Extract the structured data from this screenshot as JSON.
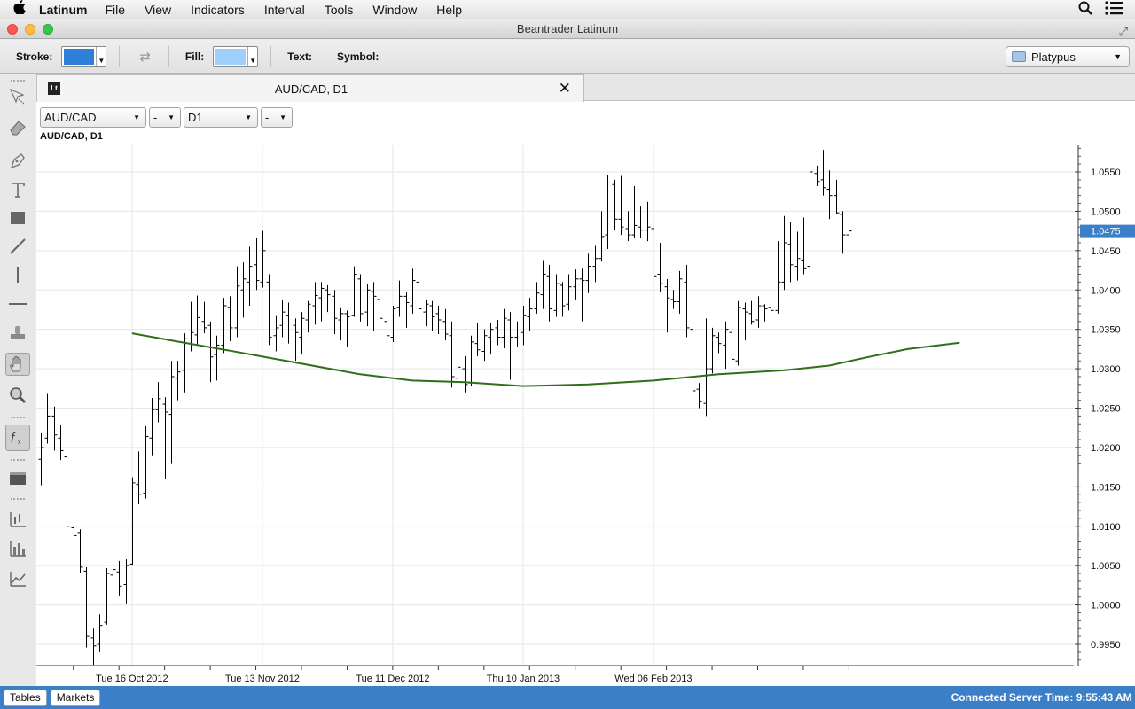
{
  "menubar": {
    "apple": "",
    "app_name": "Latinum",
    "items": [
      "File",
      "View",
      "Indicators",
      "Interval",
      "Tools",
      "Window",
      "Help"
    ],
    "icons": [
      "search-icon",
      "list-icon"
    ]
  },
  "window": {
    "title": "Beantrader Latinum"
  },
  "toolbar": {
    "stroke_label": "Stroke:",
    "stroke_color": "#2f7fd6",
    "fill_label": "Fill:",
    "fill_color": "#9fd0fb",
    "text_label": "Text:",
    "symbol_label": "Symbol:",
    "workspace": "Platypus"
  },
  "tab": {
    "logo": "Lt",
    "title": "AUD/CAD, D1"
  },
  "selectors": {
    "pair": "AUD/CAD",
    "pair_option": "-",
    "timeframe": "D1",
    "timeframe_option": "-"
  },
  "chart_label": "AUD/CAD, D1",
  "statusbar": {
    "tables_label": "Tables",
    "markets_label": "Markets",
    "status": "Connected  Server Time: 9:55:43 AM t"
  },
  "chart_data": {
    "type": "ohlc",
    "symbol": "AUD/CAD",
    "timeframe": "D1",
    "ylim": [
      0.9925,
      1.058
    ],
    "y_ticks": [
      "1.0550",
      "1.0500",
      "1.0450",
      "1.0400",
      "1.0350",
      "1.0300",
      "1.0250",
      "1.0200",
      "1.0150",
      "1.0100",
      "1.0050",
      "1.0000",
      "0.9950"
    ],
    "x_labels": [
      "Tue 16 Oct 2012",
      "Tue 13 Nov 2012",
      "Tue 11 Dec 2012",
      "Thu 10 Jan 2013",
      "Wed 06 Feb 2013"
    ],
    "x_label_bar_index": [
      14,
      34,
      54,
      74,
      94
    ],
    "current_price": "1.0475",
    "colors": {
      "bars": "#000000",
      "moving_average": "#2f6e1a",
      "price_marker": "#3a7fc8",
      "grid": "#e6e6e6"
    },
    "bars": [
      {
        "o": 1.0185,
        "h": 1.0218,
        "l": 1.0152,
        "c": 1.02
      },
      {
        "o": 1.0212,
        "h": 1.0268,
        "l": 1.0205,
        "c": 1.024
      },
      {
        "o": 1.024,
        "h": 1.0252,
        "l": 1.0196,
        "c": 1.0216
      },
      {
        "o": 1.0212,
        "h": 1.0228,
        "l": 1.0184,
        "c": 1.0196
      },
      {
        "o": 1.0188,
        "h": 1.0196,
        "l": 1.0092,
        "c": 1.01
      },
      {
        "o": 1.0098,
        "h": 1.0108,
        "l": 1.0052,
        "c": 1.0088
      },
      {
        "o": 1.0092,
        "h": 1.0096,
        "l": 1.004,
        "c": 1.0048
      },
      {
        "o": 1.0043,
        "h": 1.0048,
        "l": 0.9946,
        "c": 0.996
      },
      {
        "o": 0.9958,
        "h": 0.997,
        "l": 0.9924,
        "c": 0.9948
      },
      {
        "o": 0.995,
        "h": 0.9988,
        "l": 0.994,
        "c": 0.9974
      },
      {
        "o": 0.9978,
        "h": 1.0047,
        "l": 0.9975,
        "c": 1.004
      },
      {
        "o": 1.0038,
        "h": 1.009,
        "l": 1.0022,
        "c": 1.0045
      },
      {
        "o": 1.0042,
        "h": 1.0056,
        "l": 1.0012,
        "c": 1.0024
      },
      {
        "o": 1.0026,
        "h": 1.0058,
        "l": 1.0002,
        "c": 1.005
      },
      {
        "o": 1.0052,
        "h": 1.0162,
        "l": 1.005,
        "c": 1.0155
      },
      {
        "o": 1.0153,
        "h": 1.0195,
        "l": 1.0128,
        "c": 1.014
      },
      {
        "o": 1.0142,
        "h": 1.0227,
        "l": 1.0135,
        "c": 1.0214
      },
      {
        "o": 1.0212,
        "h": 1.0263,
        "l": 1.019,
        "c": 1.0248
      },
      {
        "o": 1.0248,
        "h": 1.0283,
        "l": 1.0232,
        "c": 1.0262
      },
      {
        "o": 1.0255,
        "h": 1.0264,
        "l": 1.016,
        "c": 1.0245
      },
      {
        "o": 1.0242,
        "h": 1.031,
        "l": 1.018,
        "c": 1.029
      },
      {
        "o": 1.0288,
        "h": 1.031,
        "l": 1.026,
        "c": 1.0296
      },
      {
        "o": 1.0298,
        "h": 1.0345,
        "l": 1.027,
        "c": 1.0338
      },
      {
        "o": 1.0332,
        "h": 1.0385,
        "l": 1.0322,
        "c": 1.0346
      },
      {
        "o": 1.0343,
        "h": 1.0393,
        "l": 1.033,
        "c": 1.0365
      },
      {
        "o": 1.036,
        "h": 1.0385,
        "l": 1.0345,
        "c": 1.0352
      },
      {
        "o": 1.0355,
        "h": 1.036,
        "l": 1.0283,
        "c": 1.0315
      },
      {
        "o": 1.0318,
        "h": 1.0342,
        "l": 1.0285,
        "c": 1.033
      },
      {
        "o": 1.033,
        "h": 1.039,
        "l": 1.032,
        "c": 1.038
      },
      {
        "o": 1.0378,
        "h": 1.0392,
        "l": 1.0335,
        "c": 1.0352
      },
      {
        "o": 1.0352,
        "h": 1.043,
        "l": 1.034,
        "c": 1.0405
      },
      {
        "o": 1.04,
        "h": 1.0435,
        "l": 1.0365,
        "c": 1.0414
      },
      {
        "o": 1.041,
        "h": 1.0455,
        "l": 1.038,
        "c": 1.043
      },
      {
        "o": 1.0432,
        "h": 1.0466,
        "l": 1.04,
        "c": 1.0412
      },
      {
        "o": 1.041,
        "h": 1.0475,
        "l": 1.0403,
        "c": 1.045
      },
      {
        "o": 1.041,
        "h": 1.042,
        "l": 1.033,
        "c": 1.034
      },
      {
        "o": 1.0342,
        "h": 1.0368,
        "l": 1.0322,
        "c": 1.0352
      },
      {
        "o": 1.0355,
        "h": 1.0388,
        "l": 1.034,
        "c": 1.0372
      },
      {
        "o": 1.0368,
        "h": 1.0384,
        "l": 1.0332,
        "c": 1.0358
      },
      {
        "o": 1.0355,
        "h": 1.0364,
        "l": 1.031,
        "c": 1.0346
      },
      {
        "o": 1.034,
        "h": 1.0372,
        "l": 1.0318,
        "c": 1.0364
      },
      {
        "o": 1.0362,
        "h": 1.0386,
        "l": 1.0346,
        "c": 1.0382
      },
      {
        "o": 1.038,
        "h": 1.041,
        "l": 1.0356,
        "c": 1.0393
      },
      {
        "o": 1.039,
        "h": 1.041,
        "l": 1.036,
        "c": 1.0402
      },
      {
        "o": 1.04,
        "h": 1.0406,
        "l": 1.0372,
        "c": 1.0394
      },
      {
        "o": 1.0392,
        "h": 1.04,
        "l": 1.0344,
        "c": 1.0364
      },
      {
        "o": 1.0362,
        "h": 1.0378,
        "l": 1.0336,
        "c": 1.037
      },
      {
        "o": 1.037,
        "h": 1.0374,
        "l": 1.0328,
        "c": 1.0366
      },
      {
        "o": 1.0368,
        "h": 1.043,
        "l": 1.0366,
        "c": 1.042
      },
      {
        "o": 1.0414,
        "h": 1.042,
        "l": 1.036,
        "c": 1.037
      },
      {
        "o": 1.0372,
        "h": 1.0408,
        "l": 1.0354,
        "c": 1.04
      },
      {
        "o": 1.0398,
        "h": 1.041,
        "l": 1.0348,
        "c": 1.0392
      },
      {
        "o": 1.0388,
        "h": 1.0398,
        "l": 1.0336,
        "c": 1.0364
      },
      {
        "o": 1.036,
        "h": 1.0366,
        "l": 1.0318,
        "c": 1.0342
      },
      {
        "o": 1.034,
        "h": 1.038,
        "l": 1.0334,
        "c": 1.0376
      },
      {
        "o": 1.0378,
        "h": 1.0412,
        "l": 1.0366,
        "c": 1.0392
      },
      {
        "o": 1.0392,
        "h": 1.0398,
        "l": 1.0352,
        "c": 1.0384
      },
      {
        "o": 1.038,
        "h": 1.0428,
        "l": 1.037,
        "c": 1.0412
      },
      {
        "o": 1.041,
        "h": 1.0418,
        "l": 1.0362,
        "c": 1.0376
      },
      {
        "o": 1.0372,
        "h": 1.0388,
        "l": 1.0354,
        "c": 1.0382
      },
      {
        "o": 1.038,
        "h": 1.0386,
        "l": 1.0348,
        "c": 1.0366
      },
      {
        "o": 1.037,
        "h": 1.038,
        "l": 1.0344,
        "c": 1.0362
      },
      {
        "o": 1.036,
        "h": 1.0376,
        "l": 1.0336,
        "c": 1.0344
      },
      {
        "o": 1.0342,
        "h": 1.036,
        "l": 1.0276,
        "c": 1.029
      },
      {
        "o": 1.0288,
        "h": 1.0312,
        "l": 1.0276,
        "c": 1.0302
      },
      {
        "o": 1.03,
        "h": 1.0316,
        "l": 1.027,
        "c": 1.028
      },
      {
        "o": 1.0282,
        "h": 1.0342,
        "l": 1.0278,
        "c": 1.0334
      },
      {
        "o": 1.0332,
        "h": 1.0358,
        "l": 1.0316,
        "c": 1.0324
      },
      {
        "o": 1.0322,
        "h": 1.035,
        "l": 1.031,
        "c": 1.0342
      },
      {
        "o": 1.034,
        "h": 1.0358,
        "l": 1.0318,
        "c": 1.035
      },
      {
        "o": 1.0352,
        "h": 1.0362,
        "l": 1.033,
        "c": 1.034
      },
      {
        "o": 1.034,
        "h": 1.0376,
        "l": 1.0326,
        "c": 1.0364
      },
      {
        "o": 1.0362,
        "h": 1.0372,
        "l": 1.0286,
        "c": 1.034
      },
      {
        "o": 1.034,
        "h": 1.036,
        "l": 1.0328,
        "c": 1.0348
      },
      {
        "o": 1.0346,
        "h": 1.038,
        "l": 1.033,
        "c": 1.0368
      },
      {
        "o": 1.0366,
        "h": 1.039,
        "l": 1.0348,
        "c": 1.0376
      },
      {
        "o": 1.0376,
        "h": 1.041,
        "l": 1.037,
        "c": 1.0396
      },
      {
        "o": 1.0394,
        "h": 1.0438,
        "l": 1.0376,
        "c": 1.042
      },
      {
        "o": 1.0418,
        "h": 1.0432,
        "l": 1.036,
        "c": 1.0376
      },
      {
        "o": 1.0374,
        "h": 1.042,
        "l": 1.0366,
        "c": 1.0408
      },
      {
        "o": 1.0406,
        "h": 1.041,
        "l": 1.0366,
        "c": 1.038
      },
      {
        "o": 1.0382,
        "h": 1.042,
        "l": 1.0374,
        "c": 1.0404
      },
      {
        "o": 1.0404,
        "h": 1.0426,
        "l": 1.0388,
        "c": 1.0414
      },
      {
        "o": 1.0414,
        "h": 1.0428,
        "l": 1.036,
        "c": 1.0412
      },
      {
        "o": 1.0412,
        "h": 1.0446,
        "l": 1.0396,
        "c": 1.043
      },
      {
        "o": 1.043,
        "h": 1.0456,
        "l": 1.041,
        "c": 1.044
      },
      {
        "o": 1.044,
        "h": 1.05,
        "l": 1.0436,
        "c": 1.0468
      },
      {
        "o": 1.047,
        "h": 1.0546,
        "l": 1.0452,
        "c": 1.0536
      },
      {
        "o": 1.0534,
        "h": 1.054,
        "l": 1.0476,
        "c": 1.049
      },
      {
        "o": 1.049,
        "h": 1.0545,
        "l": 1.047,
        "c": 1.048
      },
      {
        "o": 1.0478,
        "h": 1.05,
        "l": 1.0462,
        "c": 1.047
      },
      {
        "o": 1.047,
        "h": 1.0532,
        "l": 1.0466,
        "c": 1.0482
      },
      {
        "o": 1.048,
        "h": 1.0506,
        "l": 1.0466,
        "c": 1.0476
      },
      {
        "o": 1.0476,
        "h": 1.0512,
        "l": 1.0462,
        "c": 1.048
      },
      {
        "o": 1.0478,
        "h": 1.0496,
        "l": 1.039,
        "c": 1.0418
      },
      {
        "o": 1.042,
        "h": 1.046,
        "l": 1.0398,
        "c": 1.0408
      },
      {
        "o": 1.0404,
        "h": 1.0414,
        "l": 1.0346,
        "c": 1.039
      },
      {
        "o": 1.0388,
        "h": 1.04,
        "l": 1.0376,
        "c": 1.0385
      },
      {
        "o": 1.0385,
        "h": 1.0424,
        "l": 1.037,
        "c": 1.0414
      },
      {
        "o": 1.041,
        "h": 1.0432,
        "l": 1.034,
        "c": 1.0352
      },
      {
        "o": 1.035,
        "h": 1.0354,
        "l": 1.0267,
        "c": 1.0272
      },
      {
        "o": 1.0274,
        "h": 1.0282,
        "l": 1.025,
        "c": 1.0258
      },
      {
        "o": 1.0256,
        "h": 1.0364,
        "l": 1.024,
        "c": 1.03
      },
      {
        "o": 1.03,
        "h": 1.0352,
        "l": 1.0294,
        "c": 1.0342
      },
      {
        "o": 1.034,
        "h": 1.0346,
        "l": 1.032,
        "c": 1.0332
      },
      {
        "o": 1.033,
        "h": 1.036,
        "l": 1.03,
        "c": 1.035
      },
      {
        "o": 1.0346,
        "h": 1.0362,
        "l": 1.029,
        "c": 1.0312
      },
      {
        "o": 1.031,
        "h": 1.0386,
        "l": 1.0304,
        "c": 1.0378
      },
      {
        "o": 1.0376,
        "h": 1.0384,
        "l": 1.0336,
        "c": 1.0372
      },
      {
        "o": 1.037,
        "h": 1.0386,
        "l": 1.0356,
        "c": 1.036
      },
      {
        "o": 1.0362,
        "h": 1.0392,
        "l": 1.0352,
        "c": 1.038
      },
      {
        "o": 1.038,
        "h": 1.0382,
        "l": 1.036,
        "c": 1.0376
      },
      {
        "o": 1.0378,
        "h": 1.0415,
        "l": 1.0355,
        "c": 1.0374
      },
      {
        "o": 1.0374,
        "h": 1.0462,
        "l": 1.037,
        "c": 1.041
      },
      {
        "o": 1.041,
        "h": 1.0494,
        "l": 1.04,
        "c": 1.046
      },
      {
        "o": 1.0458,
        "h": 1.0486,
        "l": 1.041,
        "c": 1.0432
      },
      {
        "o": 1.043,
        "h": 1.0474,
        "l": 1.0412,
        "c": 1.044
      },
      {
        "o": 1.0438,
        "h": 1.0492,
        "l": 1.042,
        "c": 1.0428
      },
      {
        "o": 1.043,
        "h": 1.0576,
        "l": 1.042,
        "c": 1.055
      },
      {
        "o": 1.0548,
        "h": 1.0558,
        "l": 1.0532,
        "c": 1.0538
      },
      {
        "o": 1.054,
        "h": 1.0578,
        "l": 1.052,
        "c": 1.053
      },
      {
        "o": 1.0528,
        "h": 1.0552,
        "l": 1.049,
        "c": 1.052
      },
      {
        "o": 1.052,
        "h": 1.054,
        "l": 1.0496,
        "c": 1.0498
      },
      {
        "o": 1.0496,
        "h": 1.05,
        "l": 1.0446,
        "c": 1.047
      },
      {
        "o": 1.047,
        "h": 1.0545,
        "l": 1.044,
        "c": 1.0475
      }
    ],
    "moving_average_anchors": [
      {
        "i": 14,
        "v": 1.0345
      },
      {
        "i": 20,
        "v": 1.0336
      },
      {
        "i": 29,
        "v": 1.0323
      },
      {
        "i": 39,
        "v": 1.0308
      },
      {
        "i": 49,
        "v": 1.0293
      },
      {
        "i": 57,
        "v": 1.0285
      },
      {
        "i": 65,
        "v": 1.0283
      },
      {
        "i": 74,
        "v": 1.0278
      },
      {
        "i": 84,
        "v": 1.028
      },
      {
        "i": 94,
        "v": 1.0285
      },
      {
        "i": 104,
        "v": 1.0293
      },
      {
        "i": 114,
        "v": 1.0298
      },
      {
        "i": 121,
        "v": 1.0304
      },
      {
        "i": 127,
        "v": 1.0315
      },
      {
        "i": 133,
        "v": 1.0325
      },
      {
        "i": 141,
        "v": 1.0333
      }
    ]
  }
}
